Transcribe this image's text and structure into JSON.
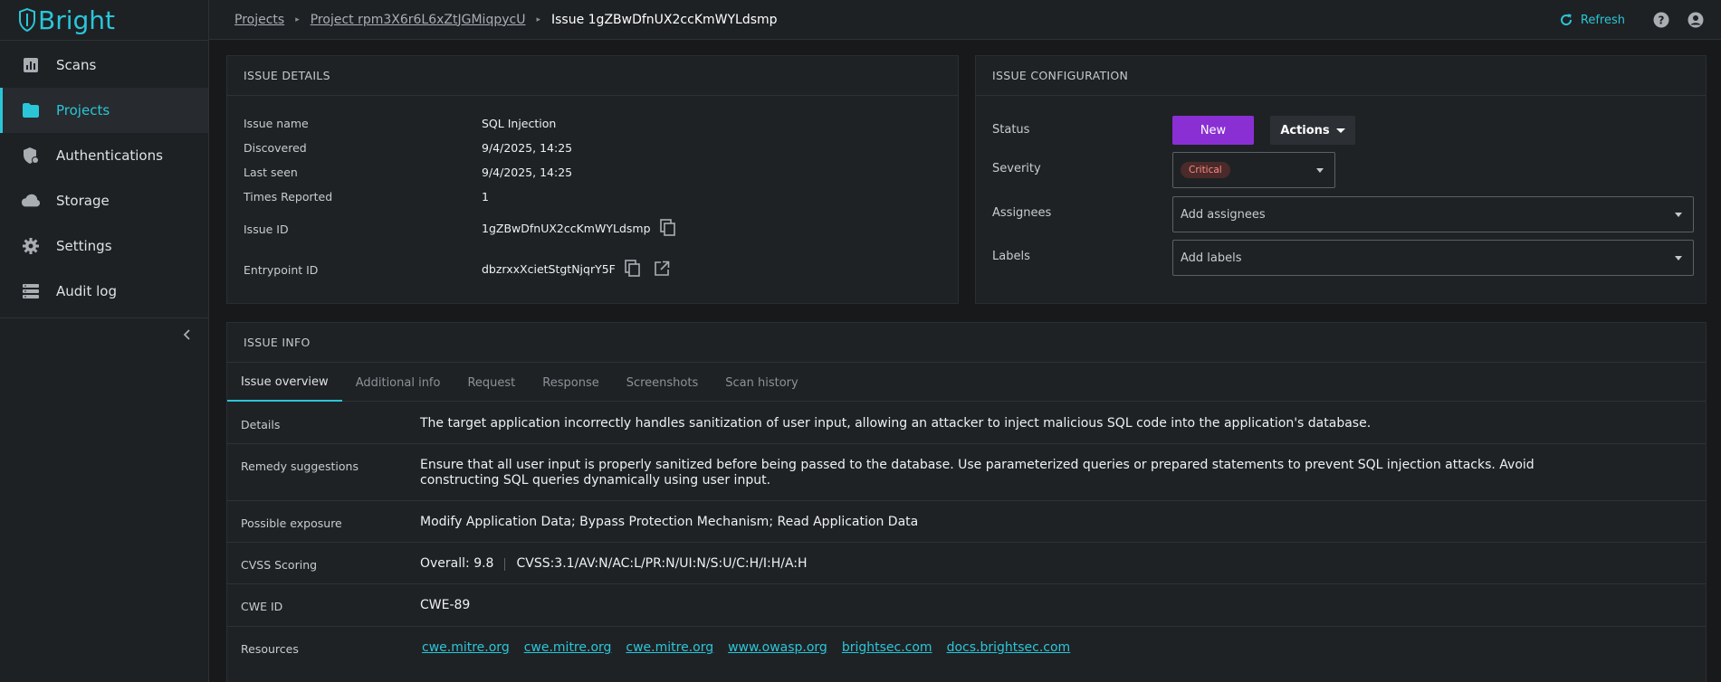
{
  "brand": {
    "name": "Bright",
    "accent": "#2ac6d8"
  },
  "sidebar": {
    "items": [
      {
        "label": "Scans",
        "icon": "bar-chart-icon"
      },
      {
        "label": "Projects",
        "icon": "folder-icon",
        "active": true
      },
      {
        "label": "Authentications",
        "icon": "shield-icon"
      },
      {
        "label": "Storage",
        "icon": "cloud-icon"
      },
      {
        "label": "Settings",
        "icon": "gear-icon"
      },
      {
        "label": "Audit log",
        "icon": "list-icon"
      }
    ]
  },
  "breadcrumb": {
    "items": [
      "Projects",
      "Project rpm3X6r6L6xZtJGMiqpycU"
    ],
    "current": "Issue 1gZBwDfnUX2ccKmWYLdsmp"
  },
  "topbar": {
    "refresh_label": "Refresh"
  },
  "issue_details": {
    "title": "ISSUE DETAILS",
    "rows": [
      {
        "label": "Issue name",
        "value": "SQL Injection"
      },
      {
        "label": "Discovered",
        "value": "9/4/2025, 14:25"
      },
      {
        "label": "Last seen",
        "value": "9/4/2025, 14:25"
      },
      {
        "label": "Times Reported",
        "value": "1"
      },
      {
        "label": "Issue ID",
        "value": "1gZBwDfnUX2ccKmWYLdsmp"
      },
      {
        "label": "Entrypoint ID",
        "value": "dbzrxxXcietStgtNjqrY5F"
      }
    ]
  },
  "issue_config": {
    "title": "ISSUE CONFIGURATION",
    "status_label": "Status",
    "status_value": "New",
    "status_color": "#8a2fd4",
    "actions_label": "Actions",
    "severity_label": "Severity",
    "severity_value": "Critical",
    "assignees_label": "Assignees",
    "assignees_placeholder": "Add assignees",
    "labels_label": "Labels",
    "labels_placeholder": "Add labels"
  },
  "issue_info": {
    "title": "ISSUE INFO",
    "tabs": [
      "Issue overview",
      "Additional info",
      "Request",
      "Response",
      "Screenshots",
      "Scan history"
    ],
    "active_tab": "Issue overview",
    "details_label": "Details",
    "details": "The target application incorrectly handles sanitization of user input, allowing an attacker to inject malicious SQL code into the application's database.",
    "remedy_label": "Remedy suggestions",
    "remedy": "Ensure that all user input is properly sanitized before being passed to the database. Use parameterized queries or prepared statements to prevent SQL injection attacks. Avoid constructing SQL queries dynamically using user input.",
    "exposure_label": "Possible exposure",
    "exposure": "Modify Application Data; Bypass Protection Mechanism; Read Application Data",
    "cvss_label": "CVSS Scoring",
    "cvss_overall": "Overall: 9.8",
    "cvss_vector": "CVSS:3.1/AV:N/AC:L/PR:N/UI:N/S:U/C:H/I:H/A:H",
    "cwe_label": "CWE ID",
    "cwe": "CWE-89",
    "resources_label": "Resources",
    "resources": [
      "cwe.mitre.org",
      "cwe.mitre.org",
      "cwe.mitre.org",
      "www.owasp.org",
      "brightsec.com",
      "docs.brightsec.com"
    ]
  }
}
